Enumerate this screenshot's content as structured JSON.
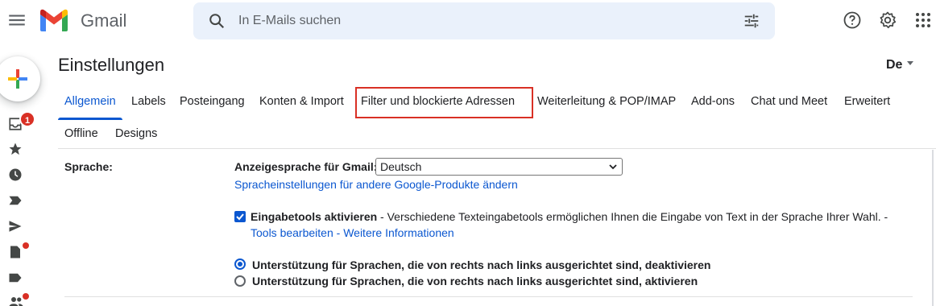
{
  "header": {
    "brand": "Gmail",
    "search_placeholder": "In E-Mails suchen"
  },
  "rail": {
    "inbox_badge": "1"
  },
  "page": {
    "title": "Einstellungen",
    "language_indicator": "De"
  },
  "tabs": [
    {
      "label": "Allgemein",
      "active": true
    },
    {
      "label": "Labels"
    },
    {
      "label": "Posteingang"
    },
    {
      "label": "Konten & Import"
    },
    {
      "label": "Filter und blockierte Adressen"
    },
    {
      "label": "Weiterleitung & POP/IMAP"
    },
    {
      "label": "Add-ons"
    },
    {
      "label": "Chat und Meet"
    },
    {
      "label": "Erweitert"
    },
    {
      "label": "Offline"
    },
    {
      "label": "Designs"
    }
  ],
  "settings": {
    "section_label": "Sprache:",
    "display_language_label": "Anzeigesprache für Gmail:",
    "display_language_value": "Deutsch",
    "other_products_link": "Spracheinstellungen für andere Google-Produkte ändern",
    "input_tools_label": "Eingabetools aktivieren",
    "input_tools_desc": " - Verschiedene Texteingabetools ermöglichen Ihnen die Eingabe von Text in der Sprache Ihrer Wahl. -",
    "edit_tools_link": "Tools bearbeiten",
    "separator": " - ",
    "more_info_link": "Weitere Informationen",
    "rtl_off": "Unterstützung für Sprachen, die von rechts nach links ausgerichtet sind, deaktivieren",
    "rtl_on": "Unterstützung für Sprachen, die von rechts nach links ausgerichtet sind, aktivieren"
  },
  "colors": {
    "accent": "#0b57d0",
    "badge": "#d93025",
    "highlight": "#d93025"
  }
}
